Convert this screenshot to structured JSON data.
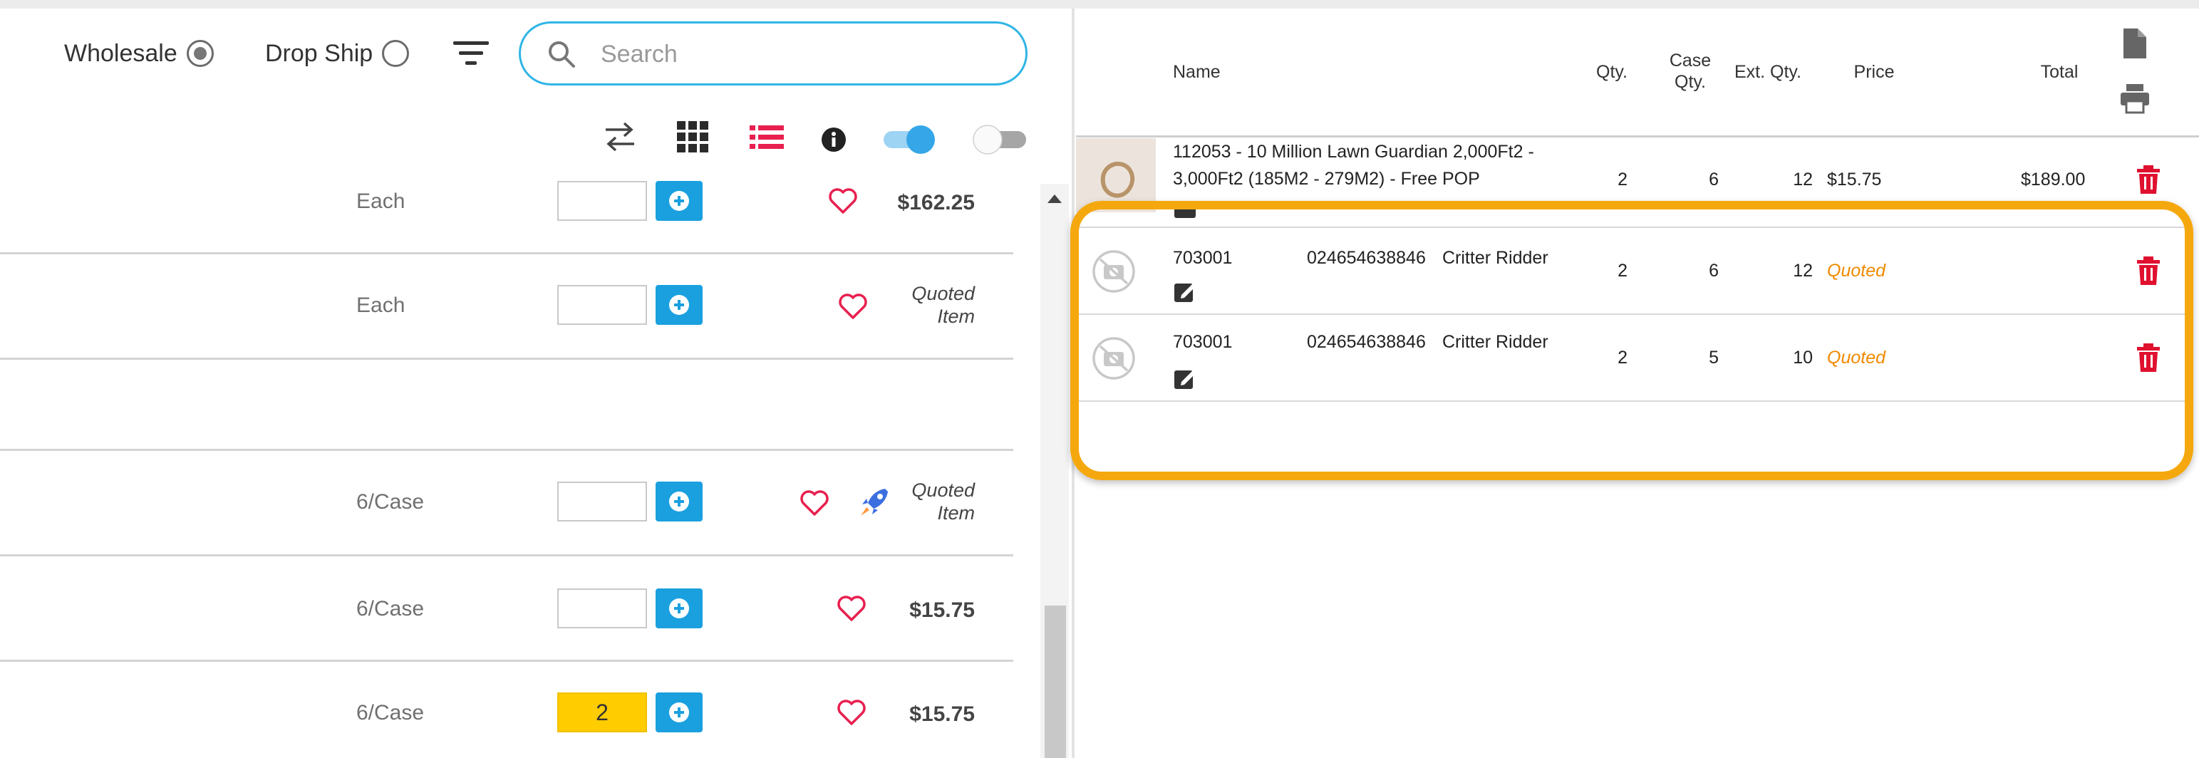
{
  "filters": {
    "wholesale_label": "Wholesale",
    "dropship_label": "Drop Ship",
    "wholesale_selected": true,
    "dropship_selected": false
  },
  "search": {
    "placeholder": "Search",
    "value": ""
  },
  "view_toolbar": {
    "icons": [
      "swap-icon",
      "grid-view-icon",
      "list-view-icon",
      "info-icon",
      "toggle-on-icon",
      "toggle-off-icon"
    ],
    "list_icon_color": "#e8204f",
    "toggle_on_color": "#35a7e8"
  },
  "product_rows": [
    {
      "unit": "Each",
      "qty": "",
      "price": "$162.25",
      "quoted": false
    },
    {
      "unit": "Each",
      "qty": "",
      "price_line1": "Quoted",
      "price_line2": "Item",
      "quoted": true
    },
    {
      "unit": "",
      "qty": "",
      "price": "",
      "empty": true
    },
    {
      "unit": "6/Case",
      "qty": "",
      "price_line1": "Quoted",
      "price_line2": "Item",
      "quoted": true,
      "has_rocket": true
    },
    {
      "unit": "6/Case",
      "qty": "",
      "price": "$15.75",
      "quoted": false
    },
    {
      "unit": "6/Case",
      "qty": "2",
      "price": "$15.75",
      "quoted": false
    }
  ],
  "cart_header": {
    "name": "Name",
    "qty": "Qty.",
    "case_qty_line1": "Case",
    "case_qty_line2": "Qty.",
    "ext_qty": "Ext. Qty.",
    "price": "Price",
    "total": "Total"
  },
  "cart_items": [
    {
      "name_line1": "112053 - 10 Million Lawn Guardian 2,000Ft2 -",
      "name_line2": "3,000Ft2 (185M2 - 279M2) - Free POP",
      "qty": "2",
      "case_qty": "6",
      "ext_qty": "12",
      "price": "$15.75",
      "total": "$189.00"
    },
    {
      "sku": "703001",
      "upc": "024654638846",
      "name": "Critter Ridder",
      "qty": "2",
      "case_qty": "6",
      "ext_qty": "12",
      "price": "Quoted",
      "total": ""
    },
    {
      "sku": "703001",
      "upc": "024654638846",
      "name": "Critter Ridder",
      "qty": "2",
      "case_qty": "5",
      "ext_qty": "10",
      "price": "Quoted",
      "total": ""
    }
  ],
  "colors": {
    "accent_blue": "#1aa0df",
    "search_border": "#30b5e6",
    "heart": "#e8204f",
    "trash": "#e0102f",
    "quoted_orange": "#f08a00",
    "highlight_orange": "#f5a80e",
    "qty_filled": "#ffcc00"
  }
}
